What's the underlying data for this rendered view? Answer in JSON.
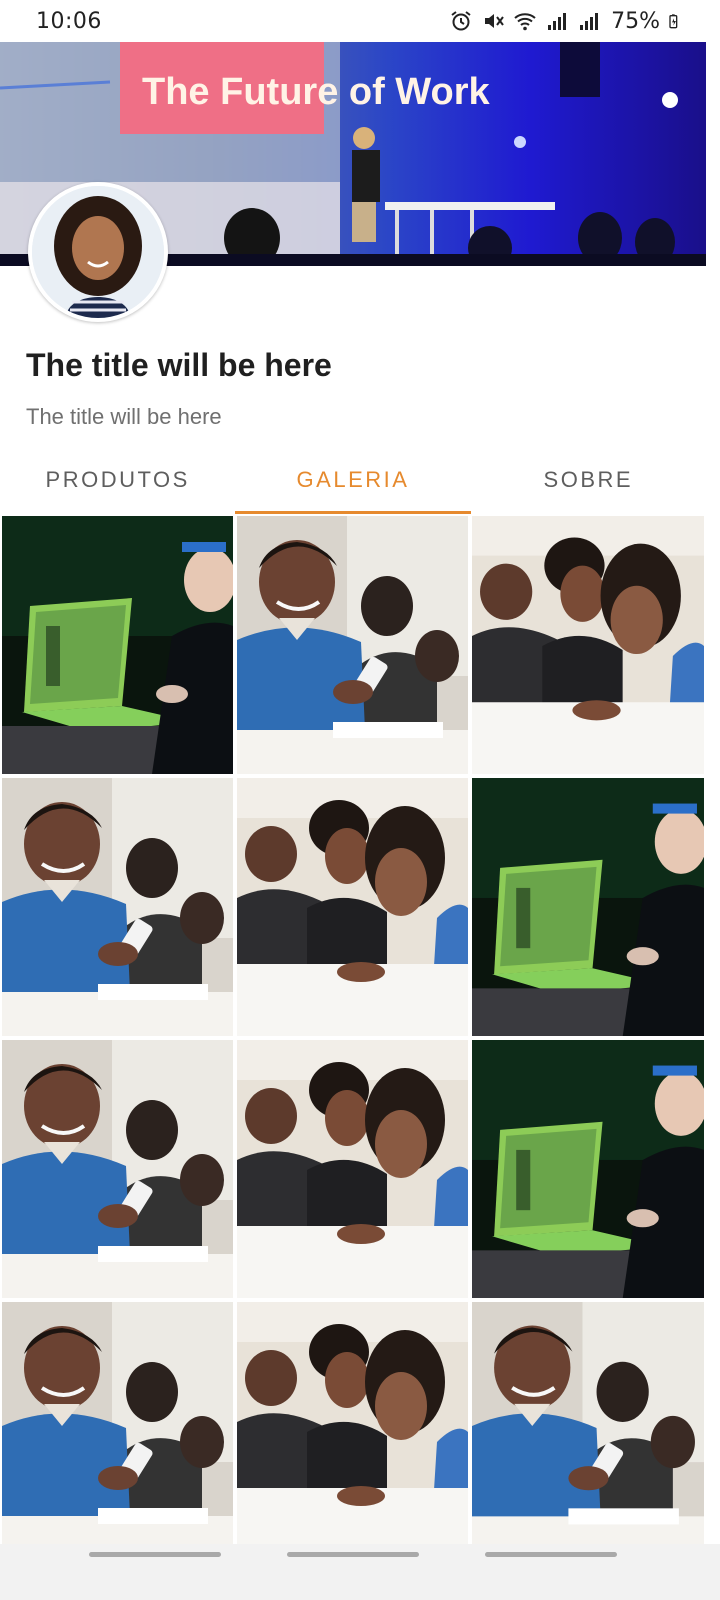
{
  "status_bar": {
    "time": "10:06",
    "battery": "75%",
    "icons": [
      "alarm-icon",
      "mute-icon",
      "wifi-icon",
      "signal-icon",
      "signal-icon",
      "battery-charging-icon"
    ]
  },
  "cover": {
    "screen_text": "The Future of Work"
  },
  "profile": {
    "title": "The title will be here",
    "subtitle": "The title will be here"
  },
  "tabs": [
    {
      "label": "PRODUTOS",
      "active": false
    },
    {
      "label": "GALERIA",
      "active": true
    },
    {
      "label": "SOBRE",
      "active": false
    }
  ],
  "gallery": {
    "photos": [
      "laptop",
      "student-phone",
      "students-reading",
      "student-phone",
      "students-reading",
      "laptop",
      "student-phone",
      "students-reading",
      "laptop",
      "student-phone",
      "students-reading",
      "student-phone"
    ]
  },
  "colors": {
    "accent": "#e68a2e",
    "tab_text": "#5e5e5e",
    "title": "#202020",
    "subtitle": "#707070"
  }
}
